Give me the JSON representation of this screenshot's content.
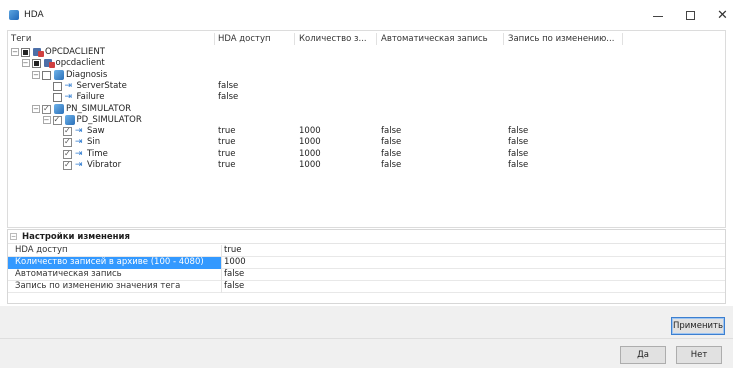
{
  "window": {
    "title": "HDA",
    "controls": {
      "minimize": "minimize",
      "maximize": "maximize",
      "close": "✕"
    }
  },
  "tree": {
    "columns": [
      "Теги",
      "HDA доступ",
      "Количество з...",
      "Автоматическая запись",
      "Запись по изменению..."
    ],
    "rows": [
      {
        "name": "OPCDACLIENT",
        "hda": "",
        "count": "",
        "auto": "",
        "change": "",
        "level": 0,
        "check": "partial",
        "icon": "server-icon"
      },
      {
        "name": "opcdaclient",
        "hda": "",
        "count": "",
        "auto": "",
        "change": "",
        "level": 1,
        "check": "partial",
        "icon": "server-icon"
      },
      {
        "name": "Diagnosis",
        "hda": "",
        "count": "",
        "auto": "",
        "change": "",
        "level": 2,
        "check": "unchecked",
        "icon": "block-icon"
      },
      {
        "name": "ServerState",
        "hda": "false",
        "count": "",
        "auto": "",
        "change": "",
        "level": 3,
        "check": "unchecked",
        "icon": "tag-icon"
      },
      {
        "name": "Failure",
        "hda": "false",
        "count": "",
        "auto": "",
        "change": "",
        "level": 3,
        "check": "unchecked",
        "icon": "tag-icon"
      },
      {
        "name": "PN_SIMULATOR",
        "hda": "",
        "count": "",
        "auto": "",
        "change": "",
        "level": 2,
        "check": "checked",
        "icon": "block-icon"
      },
      {
        "name": "PD_SIMULATOR",
        "hda": "",
        "count": "",
        "auto": "",
        "change": "",
        "level": 3,
        "check": "checked",
        "icon": "block-icon"
      },
      {
        "name": "Saw",
        "hda": "true",
        "count": "1000",
        "auto": "false",
        "change": "false",
        "level": 4,
        "check": "checked",
        "icon": "tag-icon"
      },
      {
        "name": "Sin",
        "hda": "true",
        "count": "1000",
        "auto": "false",
        "change": "false",
        "level": 4,
        "check": "checked",
        "icon": "tag-icon"
      },
      {
        "name": "Time",
        "hda": "true",
        "count": "1000",
        "auto": "false",
        "change": "false",
        "level": 4,
        "check": "checked",
        "icon": "tag-icon"
      },
      {
        "name": "Vibrator",
        "hda": "true",
        "count": "1000",
        "auto": "false",
        "change": "false",
        "level": 4,
        "check": "checked",
        "icon": "tag-icon"
      }
    ]
  },
  "properties": {
    "group_title": "Настройки изменения",
    "rows": [
      {
        "key": "HDA доступ",
        "value": "true",
        "selected": false
      },
      {
        "key": "Количество записей в архиве (100 - 4080)",
        "value": "1000",
        "selected": true
      },
      {
        "key": "Автоматическая запись",
        "value": "false",
        "selected": false
      },
      {
        "key": "Запись по изменению значения тега",
        "value": "false",
        "selected": false
      }
    ]
  },
  "buttons": {
    "apply": "Применить",
    "yes": "Да",
    "no": "Нет"
  },
  "colors": {
    "selection": "#3399ff",
    "tag_icon": "#2f7bd0",
    "default_button_border": "#3c7fd0"
  }
}
